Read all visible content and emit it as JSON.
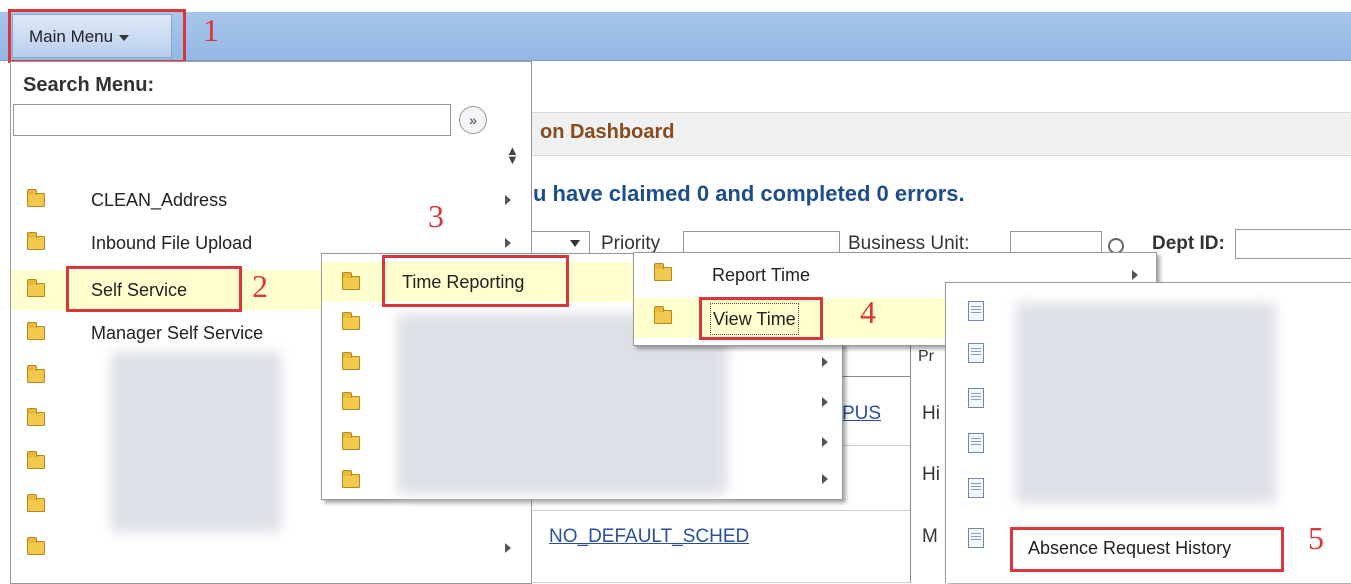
{
  "header": {
    "main_menu_label": "Main Menu"
  },
  "search": {
    "label": "Search Menu:",
    "value": "",
    "go_icon": "double-chevron-right-icon"
  },
  "background_page": {
    "dashboard_title": "on Dashboard",
    "claim_message": "u have claimed 0 and completed 0 errors.",
    "priority_label": "Priority",
    "business_unit_label": "Business Unit:",
    "dept_id_label": "Dept ID:",
    "grid_header_pr": "Pr",
    "row1_link": "PUS",
    "row1_priority": "Hi",
    "row2_priority": "Hi",
    "row3_link": "NO_DEFAULT_SCHED",
    "row3_priority": "M"
  },
  "menu_level1": {
    "items": [
      {
        "label": "CLEAN_Address"
      },
      {
        "label": "Inbound File Upload"
      },
      {
        "label": "Self Service"
      },
      {
        "label": "Manager Self Service"
      }
    ]
  },
  "menu_level2": {
    "items": [
      {
        "label": "Time Reporting"
      }
    ]
  },
  "menu_level3": {
    "items": [
      {
        "label": "Report Time"
      },
      {
        "label": "View Time"
      }
    ]
  },
  "menu_level4": {
    "items": [
      {
        "label": "Absence Request History"
      }
    ]
  },
  "annotations": [
    "1",
    "2",
    "3",
    "4",
    "5"
  ],
  "colors": {
    "highlight_box": "#d9373a",
    "menu_bar": "#a9c6ea",
    "hover_row": "#ffffd0",
    "folder": "#f2c94c"
  }
}
